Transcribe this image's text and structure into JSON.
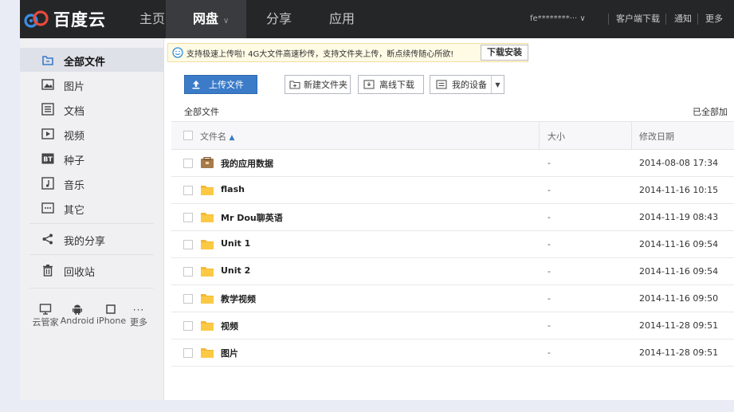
{
  "logo": {
    "text": "百度云"
  },
  "nav": {
    "home": "主页",
    "pan": "网盘",
    "share": "分享",
    "app": "应用"
  },
  "topright": {
    "user": "fe********··· ∨",
    "client": "客户端下载",
    "notify": "通知",
    "more": "更多"
  },
  "sidebar": {
    "items": [
      {
        "label": "全部文件",
        "icon": "folder-outline-icon"
      },
      {
        "label": "图片",
        "icon": "image-icon"
      },
      {
        "label": "文档",
        "icon": "document-icon"
      },
      {
        "label": "视频",
        "icon": "video-icon"
      },
      {
        "label": "种子",
        "icon": "bt-icon"
      },
      {
        "label": "音乐",
        "icon": "music-icon"
      },
      {
        "label": "其它",
        "icon": "more-icon"
      },
      {
        "label": "我的分享",
        "icon": "share-icon"
      },
      {
        "label": "回收站",
        "icon": "trash-icon"
      }
    ],
    "devices": [
      {
        "label": "云管家",
        "icon": "monitor-icon"
      },
      {
        "label": "Android",
        "icon": "android-icon"
      },
      {
        "label": "iPhone",
        "icon": "phone-icon"
      },
      {
        "label": "更多",
        "icon": "ellipsis-icon"
      }
    ]
  },
  "notice": {
    "text": "支持极速上传啦! 4G大文件高速秒传，支持文件夹上传，断点续传随心所欲!",
    "button": "下载安装",
    "icon": "smiley-icon"
  },
  "toolbar": {
    "upload": "上传文件",
    "new_folder": "新建文件夹",
    "offline": "离线下载",
    "device": "我的设备"
  },
  "breadcrumb": "全部文件",
  "loaded": "已全部加",
  "table": {
    "headers": {
      "name": "文件名",
      "size": "大小",
      "date": "修改日期"
    },
    "rows": [
      {
        "name": "我的应用数据",
        "size": "-",
        "date": "2014-08-08 17:34",
        "type": "app-folder"
      },
      {
        "name": "flash",
        "size": "-",
        "date": "2014-11-16 10:15",
        "type": "folder"
      },
      {
        "name": "Mr Dou聊英语",
        "size": "-",
        "date": "2014-11-19 08:43",
        "type": "folder"
      },
      {
        "name": "Unit 1",
        "size": "-",
        "date": "2014-11-16 09:54",
        "type": "folder"
      },
      {
        "name": "Unit 2",
        "size": "-",
        "date": "2014-11-16 09:54",
        "type": "folder"
      },
      {
        "name": "教学视频",
        "size": "-",
        "date": "2014-11-16 09:50",
        "type": "folder"
      },
      {
        "name": "视频",
        "size": "-",
        "date": "2014-11-28 09:51",
        "type": "folder"
      },
      {
        "name": "图片",
        "size": "-",
        "date": "2014-11-28 09:51",
        "type": "folder"
      }
    ]
  },
  "colors": {
    "topbar": "#252628",
    "accent": "#3b7bc8",
    "folder": "#f5b833",
    "sidebar": "#f0f0f3"
  }
}
